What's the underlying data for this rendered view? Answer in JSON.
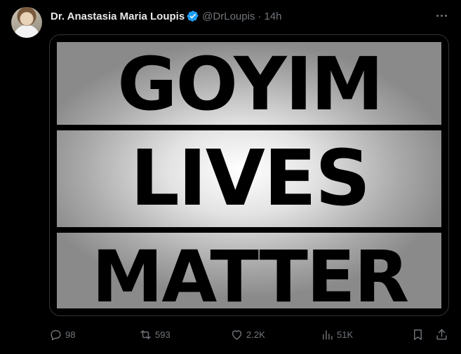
{
  "tweet": {
    "display_name": "Dr. Anastasia Maria Loupis",
    "handle": "@DrLoupis",
    "separator": "·",
    "time": "14h",
    "verified": true
  },
  "media": {
    "line_1": "GOYIM",
    "line_2": "LIVES",
    "line_3": "MATTER"
  },
  "actions": {
    "replies": "98",
    "reposts": "593",
    "likes": "2.2K",
    "views": "51K"
  },
  "colors": {
    "background": "#000000",
    "muted": "#71767b",
    "verified": "#1d9bf0",
    "text": "#e7e9ea"
  },
  "icons": {
    "more": "more-icon",
    "reply": "reply-icon",
    "repost": "repost-icon",
    "like": "like-icon",
    "views": "views-icon",
    "bookmark": "bookmark-icon",
    "share": "share-icon",
    "verified": "verified-badge-icon"
  }
}
